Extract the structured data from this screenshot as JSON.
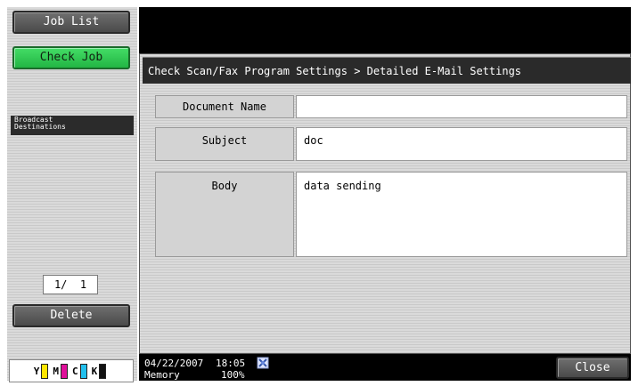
{
  "sidebar": {
    "job_list_label": "Job List",
    "check_job_label": "Check Job",
    "broadcast_label_line1": "Broadcast",
    "broadcast_label_line2": "Destinations",
    "page_counter": "1/  1",
    "delete_label": "Delete",
    "toner": [
      "Y",
      "M",
      "C",
      "K"
    ]
  },
  "header": {
    "breadcrumb": "Check Scan/Fax Program Settings > Detailed E-Mail Settings"
  },
  "fields": {
    "document_name_label": "Document Name",
    "document_name_value": "",
    "subject_label": "Subject",
    "subject_value": "doc",
    "body_label": "Body",
    "body_value": "data sending"
  },
  "status": {
    "date": "04/22/2007",
    "time": "18:05",
    "memory_label": "Memory",
    "memory_value": "100%",
    "close_label": "Close"
  },
  "colors": {
    "accent_green": "#33cc55",
    "toner_y": "#ffe600",
    "toner_m": "#e0109a",
    "toner_c": "#22c0ee",
    "toner_k": "#111111"
  }
}
